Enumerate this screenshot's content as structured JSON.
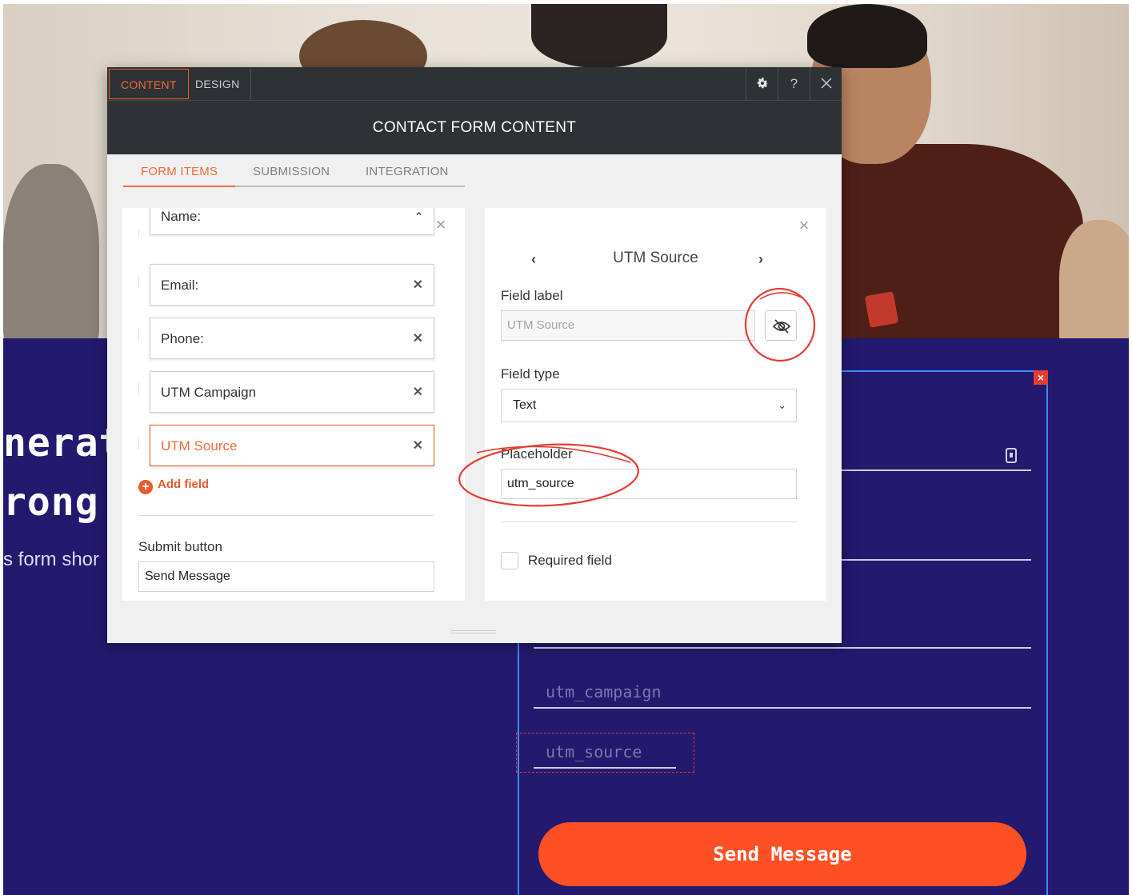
{
  "page": {
    "headline_line1": "nerat",
    "headline_line2": "rong",
    "subline": "s form shor",
    "fields": [
      {
        "placeholder": "utm_campaign"
      },
      {
        "placeholder": "utm_source"
      }
    ],
    "send_button": "Send Message",
    "block_close": "×"
  },
  "modal": {
    "top_tabs": [
      "CONTENT",
      "DESIGN"
    ],
    "top_icons": [
      "gear-icon",
      "help-icon",
      "close-icon"
    ],
    "help_label": "?",
    "title": "CONTACT FORM CONTENT",
    "sub_tabs": [
      "FORM ITEMS",
      "SUBMISSION",
      "INTEGRATION"
    ],
    "active_sub_tab": "FORM ITEMS",
    "items": [
      {
        "label": "Name:",
        "expanded": true
      },
      {
        "label": "Email:"
      },
      {
        "label": "Phone:"
      },
      {
        "label": "UTM Campaign"
      },
      {
        "label": "UTM Source",
        "active": true
      }
    ],
    "add_field": "Add field",
    "submit_label": "Submit button",
    "submit_value": "Send Message",
    "editor": {
      "field_name": "UTM Source",
      "field_label_label": "Field label",
      "field_label_value": "UTM Source",
      "field_type_label": "Field type",
      "field_type_value": "Text",
      "placeholder_label": "Placeholder",
      "placeholder_value": "utm_source",
      "required_label": "Required field",
      "required_checked": false
    }
  },
  "colors": {
    "accent": "#f26a3a",
    "toolbar_bg": "#2e3234",
    "page_bg": "#23196e",
    "send_button": "#ff4f25",
    "annotation": "#e53c32"
  }
}
